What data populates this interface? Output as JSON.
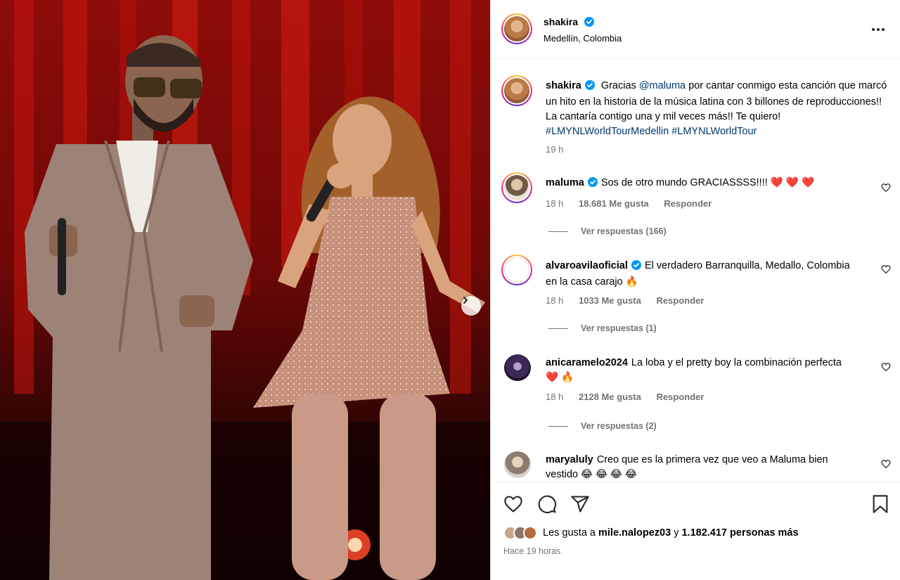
{
  "post": {
    "author": "shakira",
    "location": "Medellín, Colombia",
    "caption_mention": "@maluma",
    "caption_part1": "Gracias",
    "caption_part2": "por cantar conmigo esta canción que marcó un hito en la historia de la música latina con 3 billones de reproducciones!! La cantaría contigo una y mil veces más!! Te quiero!",
    "hashtag1": "#LMYNLWorldTourMedellin",
    "hashtag2": "#LMYNLWorldTour",
    "caption_time": "19 h"
  },
  "comments": [
    {
      "user": "maluma",
      "verified": true,
      "text": "Sos de otro mundo GRACIASSSS!!!! ❤️ ❤️ ❤️",
      "time": "18 h",
      "likes": "18.681 Me gusta",
      "reply": "Responder",
      "view_replies": "Ver respuestas (166)"
    },
    {
      "user": "alvaroavilaoficial",
      "verified": true,
      "text": "El verdadero Barranquilla, Medallo, Colombia en la casa carajo 🔥",
      "time": "18 h",
      "likes": "1033 Me gusta",
      "reply": "Responder",
      "view_replies": "Ver respuestas (1)"
    },
    {
      "user": "anicaramelo2024",
      "verified": false,
      "text": "La loba y el pretty boy la combinación perfecta ❤️ 🔥",
      "time": "18 h",
      "likes": "2128 Me gusta",
      "reply": "Responder",
      "view_replies": "Ver respuestas (2)"
    },
    {
      "user": "maryaluly",
      "verified": false,
      "text": "Creo que es la primera vez que veo a Maluma bien vestido 😂 😂 😂 😂"
    }
  ],
  "footer": {
    "likes_prefix": "Les gusta a",
    "likes_user": "mile.nalopez03",
    "likes_and": "y",
    "likes_count": "1.182.417 personas más",
    "posted": "Hace 19 horas"
  },
  "icons": {
    "like": "heart-icon",
    "comment": "comment-icon",
    "share": "share-icon",
    "save": "bookmark-icon",
    "more": "more-icon",
    "verified": "verified-badge-icon",
    "next": "chevron-right-icon"
  },
  "colors": {
    "verified": "#0095f6",
    "link": "#00376b",
    "muted": "#737373",
    "stage_red": "#8e0c09"
  }
}
